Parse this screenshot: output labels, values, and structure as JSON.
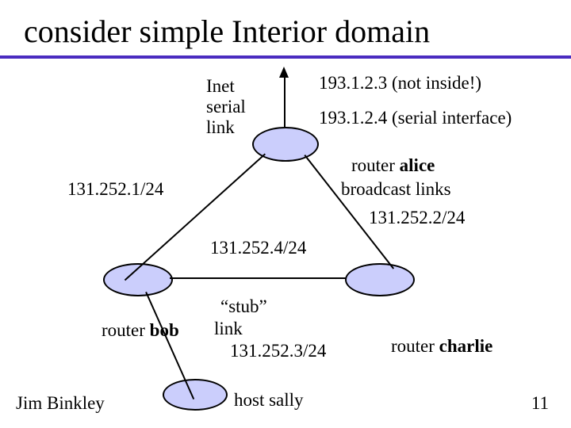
{
  "title": "consider simple Interior domain",
  "author": "Jim Binkley",
  "pagenum": "11",
  "inet": {
    "l1": "Inet",
    "l2": "serial",
    "l3": "link"
  },
  "alice": {
    "not_inside": "193.1.2.3 (not inside!)",
    "serial_if": "193.1.2.4 (serial interface)",
    "name_pre": "router ",
    "name_bold": "alice"
  },
  "left_net": "131.252.1/24",
  "broadcast": "broadcast links",
  "right_net": "131.252.2/24",
  "mid_net": "131.252.4/24",
  "bob": {
    "name_pre": "router ",
    "name_bold": "bob"
  },
  "stub": {
    "l1": "“stub”",
    "l2": "link",
    "l3_pre": "  ",
    "l3": "131.252.3/24"
  },
  "charlie": {
    "name_pre": "router ",
    "name_bold": "charlie"
  },
  "sally": "host sally"
}
